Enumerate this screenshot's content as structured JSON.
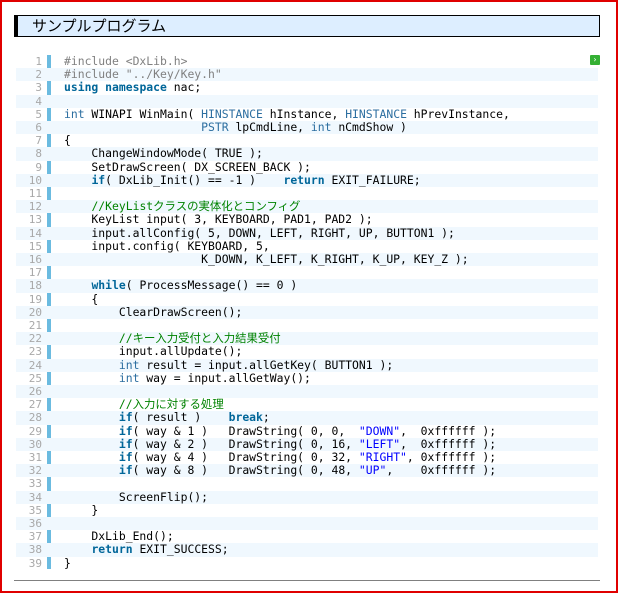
{
  "title": "サンプルプログラム",
  "toggle_icon": "expand-icon",
  "colors": {
    "frame_border": "#e00000",
    "title_bg": "#ddeeff",
    "keyword": "#006699",
    "comment": "#008200",
    "string": "#0000ff",
    "gutter_bar": "#6bbbe0"
  },
  "lines": [
    {
      "n": "1",
      "parts": [
        [
          "pp",
          "#include <DxLib.h>"
        ]
      ]
    },
    {
      "n": "2",
      "parts": [
        [
          "pp",
          "#include \"../Key/Key.h\""
        ]
      ]
    },
    {
      "n": "3",
      "parts": [
        [
          "kw",
          "using"
        ],
        [
          "",
          " "
        ],
        [
          "kw",
          "namespace"
        ],
        [
          "",
          " nac;"
        ]
      ]
    },
    {
      "n": "4",
      "parts": [
        [
          "",
          ""
        ]
      ]
    },
    {
      "n": "5",
      "parts": [
        [
          "ty",
          "int"
        ],
        [
          "",
          " WINAPI WinMain( "
        ],
        [
          "ty",
          "HINSTANCE"
        ],
        [
          "",
          " hInstance, "
        ],
        [
          "ty",
          "HINSTANCE"
        ],
        [
          "",
          " hPrevInstance,"
        ]
      ]
    },
    {
      "n": "6",
      "parts": [
        [
          "",
          "                    "
        ],
        [
          "ty",
          "PSTR"
        ],
        [
          "",
          " lpCmdLine, "
        ],
        [
          "ty",
          "int"
        ],
        [
          "",
          " nCmdShow )"
        ]
      ]
    },
    {
      "n": "7",
      "parts": [
        [
          "",
          "{"
        ]
      ]
    },
    {
      "n": "8",
      "parts": [
        [
          "",
          "    ChangeWindowMode( TRUE );"
        ]
      ]
    },
    {
      "n": "9",
      "parts": [
        [
          "",
          "    SetDrawScreen( DX_SCREEN_BACK );"
        ]
      ]
    },
    {
      "n": "10",
      "parts": [
        [
          "",
          "    "
        ],
        [
          "kw",
          "if"
        ],
        [
          "",
          "( DxLib_Init() == -1 )    "
        ],
        [
          "kw",
          "return"
        ],
        [
          "",
          " EXIT_FAILURE;"
        ]
      ]
    },
    {
      "n": "11",
      "parts": [
        [
          "",
          ""
        ]
      ]
    },
    {
      "n": "12",
      "parts": [
        [
          "",
          "    "
        ],
        [
          "cm",
          "//KeyListクラスの実体化とコンフィグ"
        ]
      ]
    },
    {
      "n": "13",
      "parts": [
        [
          "",
          "    KeyList input( 3, KEYBOARD, PAD1, PAD2 );"
        ]
      ]
    },
    {
      "n": "14",
      "parts": [
        [
          "",
          "    input.allConfig( 5, DOWN, LEFT, RIGHT, UP, BUTTON1 );"
        ]
      ]
    },
    {
      "n": "15",
      "parts": [
        [
          "",
          "    input.config( KEYBOARD, 5,"
        ]
      ]
    },
    {
      "n": "16",
      "parts": [
        [
          "",
          "                    K_DOWN, K_LEFT, K_RIGHT, K_UP, KEY_Z );"
        ]
      ]
    },
    {
      "n": "17",
      "parts": [
        [
          "",
          ""
        ]
      ]
    },
    {
      "n": "18",
      "parts": [
        [
          "",
          "    "
        ],
        [
          "kw",
          "while"
        ],
        [
          "",
          "( ProcessMessage() == 0 )"
        ]
      ]
    },
    {
      "n": "19",
      "parts": [
        [
          "",
          "    {"
        ]
      ]
    },
    {
      "n": "20",
      "parts": [
        [
          "",
          "        ClearDrawScreen();"
        ]
      ]
    },
    {
      "n": "21",
      "parts": [
        [
          "",
          ""
        ]
      ]
    },
    {
      "n": "22",
      "parts": [
        [
          "",
          "        "
        ],
        [
          "cm",
          "//キー入力受付と入力結果受付"
        ]
      ]
    },
    {
      "n": "23",
      "parts": [
        [
          "",
          "        input.allUpdate();"
        ]
      ]
    },
    {
      "n": "24",
      "parts": [
        [
          "",
          "        "
        ],
        [
          "ty",
          "int"
        ],
        [
          "",
          " result = input.allGetKey( BUTTON1 );"
        ]
      ]
    },
    {
      "n": "25",
      "parts": [
        [
          "",
          "        "
        ],
        [
          "ty",
          "int"
        ],
        [
          "",
          " way = input.allGetWay();"
        ]
      ]
    },
    {
      "n": "26",
      "parts": [
        [
          "",
          ""
        ]
      ]
    },
    {
      "n": "27",
      "parts": [
        [
          "",
          "        "
        ],
        [
          "cm",
          "//入力に対する処理"
        ]
      ]
    },
    {
      "n": "28",
      "parts": [
        [
          "",
          "        "
        ],
        [
          "kw",
          "if"
        ],
        [
          "",
          "( result )    "
        ],
        [
          "kw",
          "break"
        ],
        [
          "",
          ";"
        ]
      ]
    },
    {
      "n": "29",
      "parts": [
        [
          "",
          "        "
        ],
        [
          "kw",
          "if"
        ],
        [
          "",
          "( way & 1 )   DrawString( 0, 0,  "
        ],
        [
          "st",
          "\"DOWN\""
        ],
        [
          "",
          ",  0xffffff );"
        ]
      ]
    },
    {
      "n": "30",
      "parts": [
        [
          "",
          "        "
        ],
        [
          "kw",
          "if"
        ],
        [
          "",
          "( way & 2 )   DrawString( 0, 16, "
        ],
        [
          "st",
          "\"LEFT\""
        ],
        [
          "",
          ",  0xffffff );"
        ]
      ]
    },
    {
      "n": "31",
      "parts": [
        [
          "",
          "        "
        ],
        [
          "kw",
          "if"
        ],
        [
          "",
          "( way & 4 )   DrawString( 0, 32, "
        ],
        [
          "st",
          "\"RIGHT\""
        ],
        [
          "",
          ", 0xffffff );"
        ]
      ]
    },
    {
      "n": "32",
      "parts": [
        [
          "",
          "        "
        ],
        [
          "kw",
          "if"
        ],
        [
          "",
          "( way & 8 )   DrawString( 0, 48, "
        ],
        [
          "st",
          "\"UP\""
        ],
        [
          "",
          ",    0xffffff );"
        ]
      ]
    },
    {
      "n": "33",
      "parts": [
        [
          "",
          ""
        ]
      ]
    },
    {
      "n": "34",
      "parts": [
        [
          "",
          "        ScreenFlip();"
        ]
      ]
    },
    {
      "n": "35",
      "parts": [
        [
          "",
          "    }"
        ]
      ]
    },
    {
      "n": "36",
      "parts": [
        [
          "",
          ""
        ]
      ]
    },
    {
      "n": "37",
      "parts": [
        [
          "",
          "    DxLib_End();"
        ]
      ]
    },
    {
      "n": "38",
      "parts": [
        [
          "",
          "    "
        ],
        [
          "kw",
          "return"
        ],
        [
          "",
          " EXIT_SUCCESS;"
        ]
      ]
    },
    {
      "n": "39",
      "parts": [
        [
          "",
          "}"
        ]
      ]
    }
  ]
}
